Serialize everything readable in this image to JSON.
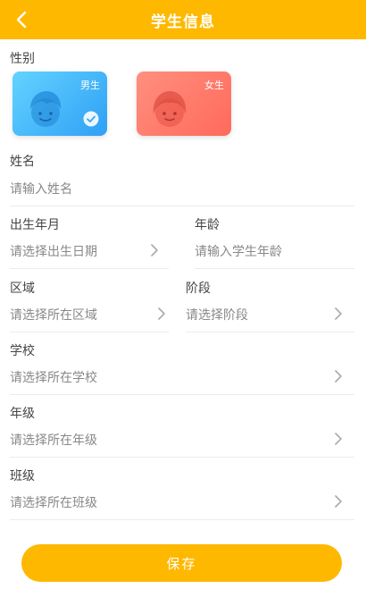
{
  "header": {
    "title": "学生信息",
    "back_icon": "chevron-left-icon"
  },
  "gender": {
    "label": "性别",
    "options": [
      {
        "text": "男生",
        "selected": true,
        "color": "#2FA0F5"
      },
      {
        "text": "女生",
        "selected": false,
        "color": "#FF6A5C"
      }
    ]
  },
  "name": {
    "label": "姓名",
    "placeholder": "请输入姓名"
  },
  "birth": {
    "label": "出生年月",
    "placeholder": "请选择出生日期"
  },
  "age": {
    "label": "年龄",
    "placeholder": "请输入学生年龄"
  },
  "region": {
    "label": "区域",
    "placeholder": "请选择所在区域"
  },
  "stage": {
    "label": "阶段",
    "placeholder": "请选择阶段"
  },
  "school": {
    "label": "学校",
    "placeholder": "请选择所在学校"
  },
  "grade": {
    "label": "年级",
    "placeholder": "请选择所在年级"
  },
  "class": {
    "label": "班级",
    "placeholder": "请选择所在班级"
  },
  "save_label": "保存",
  "colors": {
    "accent": "#FFB800"
  }
}
